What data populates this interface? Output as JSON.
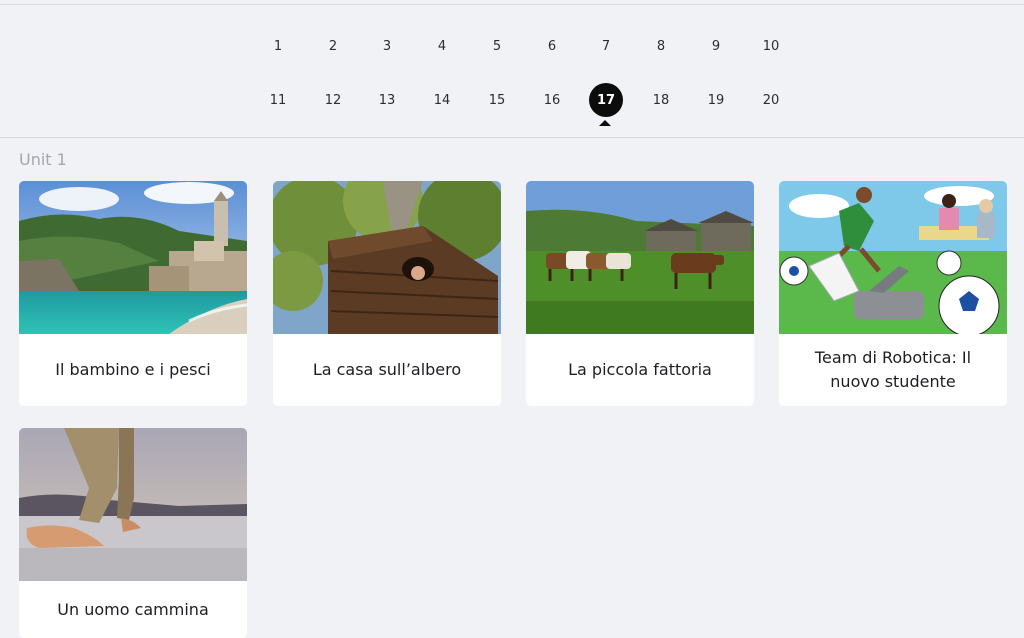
{
  "pagination": {
    "current": "17",
    "pages": [
      "1",
      "2",
      "3",
      "4",
      "5",
      "6",
      "7",
      "8",
      "9",
      "10",
      "11",
      "12",
      "13",
      "14",
      "15",
      "16",
      "17",
      "18",
      "19",
      "20"
    ]
  },
  "unit": {
    "label": "Unit 1"
  },
  "cards": [
    {
      "title": "Il bambino e i pesci",
      "image": "coastal-village-photo"
    },
    {
      "title": "La casa sull’albero",
      "image": "treehouse-photo"
    },
    {
      "title": "La piccola fattoria",
      "image": "farm-cows-photo"
    },
    {
      "title": "Team di Robotica: Il nuovo studente",
      "image": "robotics-illustration"
    },
    {
      "title": "Un uomo cammina",
      "image": "walking-feet-photo"
    }
  ],
  "colors": {
    "background": "#f1f2f6",
    "active_page": "#0c0c0c",
    "card": "#ffffff",
    "muted_text": "#a4a7ae"
  }
}
